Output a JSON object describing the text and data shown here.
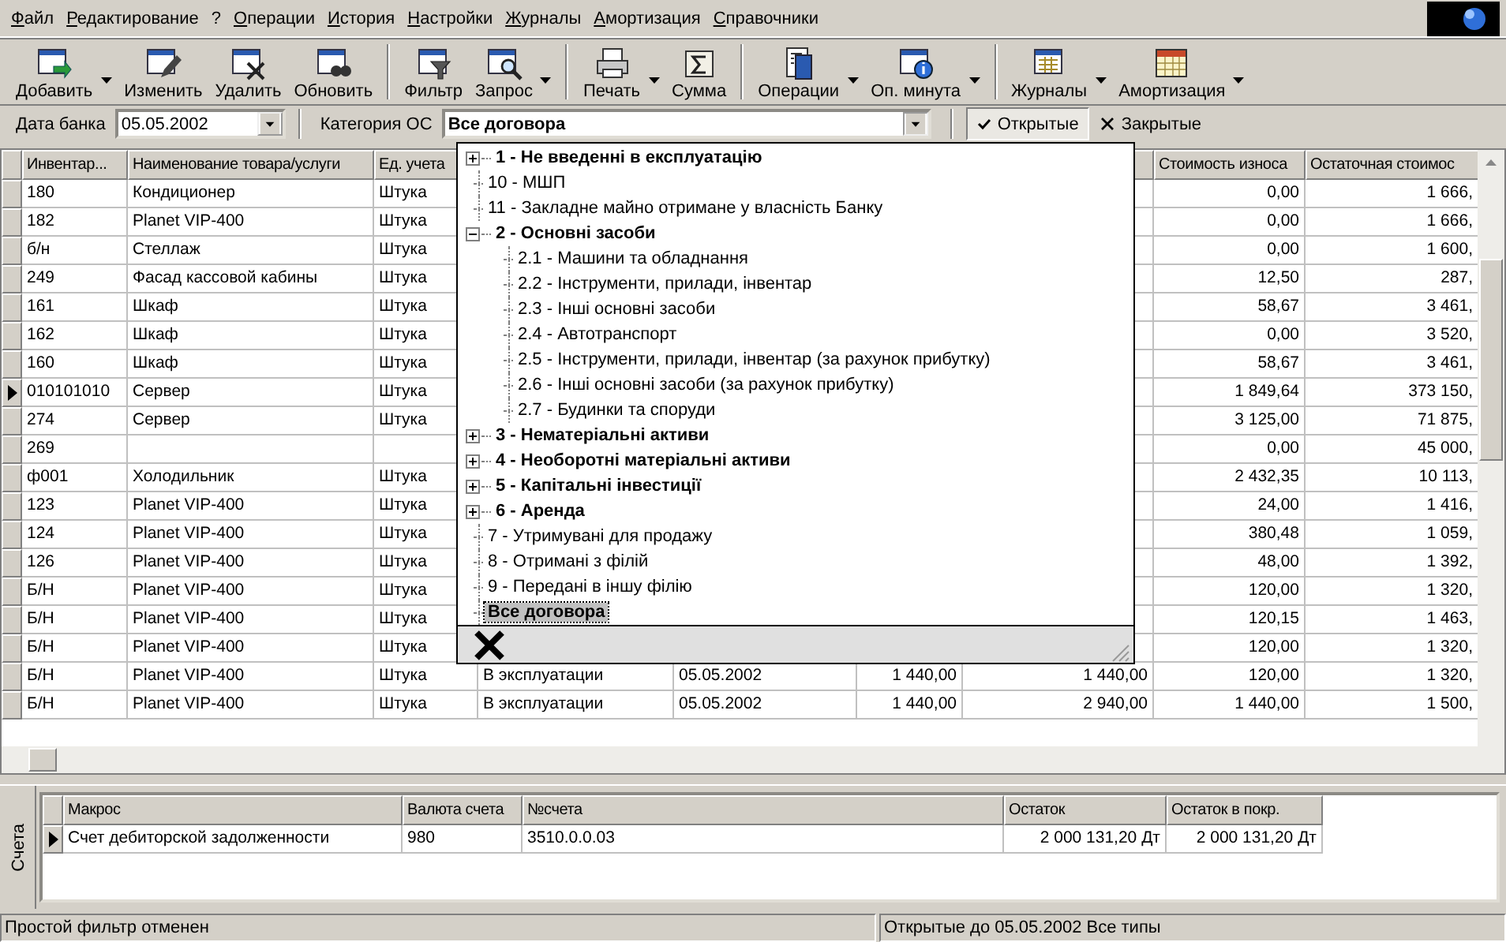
{
  "menu": [
    {
      "label": "Файл"
    },
    {
      "label": "Редактирование"
    },
    {
      "label": "?"
    },
    {
      "label": "Операции"
    },
    {
      "label": "История"
    },
    {
      "label": "Настройки"
    },
    {
      "label": "Журналы"
    },
    {
      "label": "Амортизация"
    },
    {
      "label": "Справочники"
    }
  ],
  "toolbar": {
    "groups": [
      [
        {
          "label": "Добавить",
          "caret": true
        },
        {
          "label": "Изменить",
          "caret": false
        },
        {
          "label": "Удалить",
          "caret": false
        },
        {
          "label": "Обновить",
          "caret": false
        }
      ],
      [
        {
          "label": "Фильтр",
          "caret": false
        },
        {
          "label": "Запрос",
          "caret": true
        }
      ],
      [
        {
          "label": "Печать",
          "caret": true
        },
        {
          "label": "Сумма",
          "caret": false
        }
      ],
      [
        {
          "label": "Операции",
          "caret": true
        },
        {
          "label": "Оп. минута",
          "caret": true
        }
      ],
      [
        {
          "label": "Журналы",
          "caret": true
        },
        {
          "label": "Амортизация",
          "caret": true
        }
      ]
    ]
  },
  "filters": {
    "bank_date": {
      "label": "Дата банка",
      "value": "05.05.2002"
    },
    "category": {
      "label": "Категория ОС",
      "value": "Все договора",
      "expanded": true,
      "tree": [
        {
          "label": "1 - Не введенні в експлуатацію",
          "kind": "group",
          "expanded": false,
          "selected": false
        },
        {
          "label": "10 - МШП",
          "kind": "leaf",
          "selected": false
        },
        {
          "label": "11 - Закладне майно отримане у власність Банку",
          "kind": "leaf",
          "selected": false
        },
        {
          "label": "2 - Основні засоби",
          "kind": "group",
          "expanded": true,
          "selected": false,
          "children": [
            {
              "label": "2.1 - Машини та обладнання",
              "selected": false
            },
            {
              "label": "2.2 - Інструменти, прилади, інвентар",
              "selected": false
            },
            {
              "label": "2.3 - Інші основні засоби",
              "selected": false
            },
            {
              "label": "2.4 - Автотранспорт",
              "selected": false
            },
            {
              "label": "2.5 - Інструменти, прилади, інвентар (за рахунок прибутку)",
              "selected": false
            },
            {
              "label": "2.6 - Інші основні засоби (за рахунок прибутку)",
              "selected": false
            },
            {
              "label": "2.7 - Будинки та споруди",
              "selected": false
            }
          ]
        },
        {
          "label": "3 - Нематеріальні активи",
          "kind": "group",
          "expanded": false,
          "selected": false
        },
        {
          "label": "4 - Необоротні матеріальні активи",
          "kind": "group",
          "expanded": false,
          "selected": false
        },
        {
          "label": "5 - Капітальні інвестиції",
          "kind": "group",
          "expanded": false,
          "selected": false
        },
        {
          "label": "6 - Аренда",
          "kind": "group",
          "expanded": false,
          "selected": false
        },
        {
          "label": "7 - Утримувані для продажу",
          "kind": "leaf",
          "selected": false
        },
        {
          "label": "8 - Отримані з філій",
          "kind": "leaf",
          "selected": false
        },
        {
          "label": "9 - Передані в іншу філію",
          "kind": "leaf",
          "selected": false
        },
        {
          "label": "Все договора",
          "kind": "leaf",
          "selected": true
        }
      ]
    },
    "toggles": [
      {
        "label": "Открытые",
        "selected": true
      },
      {
        "label": "Закрытые",
        "selected": false
      }
    ]
  },
  "table": {
    "columns": [
      {
        "label": "Инвентар..."
      },
      {
        "label": "Наименование товара/услуги"
      },
      {
        "label": "Ед. учета"
      },
      {},
      {},
      {},
      {},
      {
        "label": "Стоимость износа"
      },
      {
        "label": "Остаточная стоимос"
      }
    ],
    "rows": [
      {
        "selected": false,
        "cells": [
          "180",
          "Кондиционер",
          "Штука",
          null,
          null,
          null,
          null,
          "0,00",
          "1 666,"
        ]
      },
      {
        "selected": false,
        "cells": [
          "182",
          "Planet VIP-400",
          "Штука",
          null,
          null,
          null,
          null,
          "0,00",
          "1 666,"
        ]
      },
      {
        "selected": false,
        "cells": [
          "б/н",
          "Стеллаж",
          "Штука",
          null,
          null,
          null,
          null,
          "0,00",
          "1 600,"
        ]
      },
      {
        "selected": false,
        "cells": [
          "249",
          "Фасад кассовой кабины",
          "Штука",
          null,
          null,
          null,
          null,
          "12,50",
          "287,"
        ]
      },
      {
        "selected": false,
        "cells": [
          "161",
          "Шкаф",
          "Штука",
          null,
          null,
          null,
          null,
          "58,67",
          "3 461,"
        ]
      },
      {
        "selected": false,
        "cells": [
          "162",
          "Шкаф",
          "Штука",
          null,
          null,
          null,
          null,
          "0,00",
          "3 520,"
        ]
      },
      {
        "selected": false,
        "cells": [
          "160",
          "Шкаф",
          "Штука",
          null,
          null,
          null,
          null,
          "58,67",
          "3 461,"
        ]
      },
      {
        "selected": true,
        "cells": [
          "010101010",
          "Сервер",
          "Штука",
          null,
          null,
          null,
          null,
          "1 849,64",
          "373 150,"
        ]
      },
      {
        "selected": false,
        "cells": [
          "274",
          "Сервер",
          "Штука",
          null,
          null,
          null,
          null,
          "3 125,00",
          "71 875,"
        ]
      },
      {
        "selected": false,
        "cells": [
          "269",
          null,
          null,
          null,
          null,
          null,
          null,
          "0,00",
          "45 000,"
        ]
      },
      {
        "selected": false,
        "cells": [
          "ф001",
          "Холодильник",
          "Штука",
          null,
          null,
          null,
          null,
          "2 432,35",
          "10 113,"
        ]
      },
      {
        "selected": false,
        "cells": [
          "123",
          "Planet VIP-400",
          "Штука",
          null,
          null,
          null,
          null,
          "24,00",
          "1 416,"
        ]
      },
      {
        "selected": false,
        "cells": [
          "124",
          "Planet VIP-400",
          "Штука",
          null,
          null,
          null,
          null,
          "380,48",
          "1 059,"
        ]
      },
      {
        "selected": false,
        "cells": [
          "126",
          "Planet VIP-400",
          "Штука",
          null,
          null,
          null,
          null,
          "48,00",
          "1 392,"
        ]
      },
      {
        "selected": false,
        "cells": [
          "Б/Н",
          "Planet VIP-400",
          "Штука",
          null,
          null,
          null,
          null,
          "120,00",
          "1 320,"
        ]
      },
      {
        "selected": false,
        "cells": [
          "Б/Н",
          "Planet VIP-400",
          "Штука",
          null,
          null,
          null,
          null,
          "120,15",
          "1 463,"
        ]
      },
      {
        "selected": false,
        "cells": [
          "Б/Н",
          "Planet VIP-400",
          "Штука",
          null,
          null,
          null,
          null,
          "120,00",
          "1 320,"
        ]
      },
      {
        "selected": false,
        "cells": [
          "Б/Н",
          "Planet VIP-400",
          "Штука",
          "В эксплуатации",
          "05.05.2002",
          "1 440,00",
          "1 440,00",
          "120,00",
          "1 320,"
        ]
      },
      {
        "selected": false,
        "cells": [
          "Б/Н",
          "Planet VIP-400",
          "Штука",
          "В эксплуатации",
          "05.05.2002",
          "1 440,00",
          "2 940,00",
          "1 440,00",
          "1 500,"
        ]
      }
    ]
  },
  "accounts": {
    "tab": "Счета",
    "columns": [
      "Макрос",
      "Валюта счета",
      "№счета",
      "Остаток",
      "Остаток в покр."
    ],
    "rows": [
      {
        "selected": true,
        "cells": [
          "Счет дебиторской задолженности",
          "980",
          "3510.0.0.03",
          "2 000 131,20 Дт",
          "2 000 131,20 Дт"
        ]
      }
    ]
  },
  "status_bar": [
    "Простой фильтр отменен",
    "Открытые до 05.05.2002 Все типы"
  ]
}
